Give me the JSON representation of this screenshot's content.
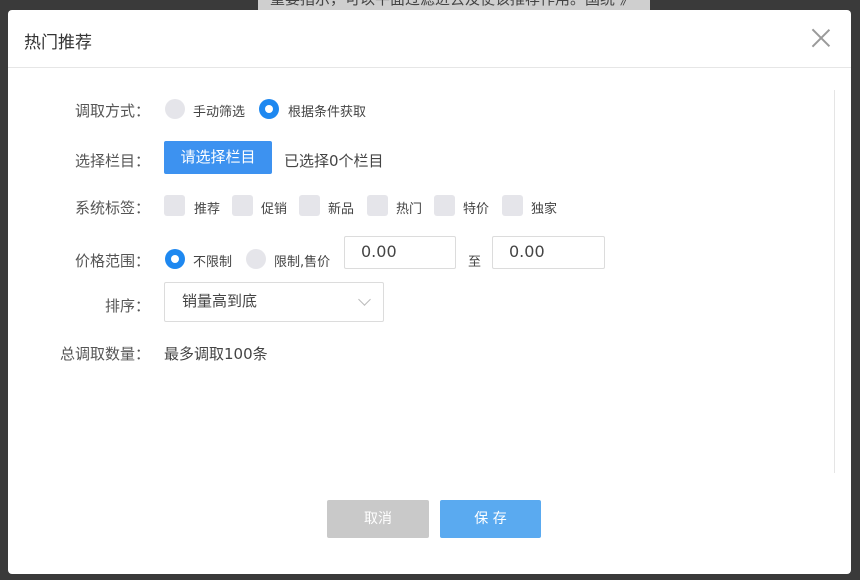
{
  "background": {
    "text": "重要指示，可以平面过滤进去及使该推荐作用。国统 》"
  },
  "dialog": {
    "title": "热门推荐",
    "fields": {
      "fetch_mode": {
        "label": "调取方式：",
        "options": [
          "手动筛选",
          "根据条件获取"
        ],
        "selected": "根据条件获取"
      },
      "column": {
        "label": "选择栏目：",
        "button": "请选择栏目",
        "status": "已选择0个栏目"
      },
      "tags": {
        "label": "系统标签：",
        "options": [
          "推荐",
          "促销",
          "新品",
          "热门",
          "特价",
          "独家"
        ]
      },
      "price": {
        "label": "价格范围：",
        "options": [
          "不限制",
          "限制,售价"
        ],
        "selected": "不限制",
        "min": "0.00",
        "separator": "至",
        "max": "0.00"
      },
      "sort": {
        "label": "排序：",
        "value": "销量高到底"
      },
      "total": {
        "label": "总调取数量：",
        "value": "最多调取100条"
      }
    },
    "footer": {
      "cancel": "取消",
      "save": "保 存"
    },
    "colors": {
      "accent": "#3d92f0",
      "cancel_bg": "#c9c9c9",
      "save_bg": "#5aaaf0"
    }
  }
}
